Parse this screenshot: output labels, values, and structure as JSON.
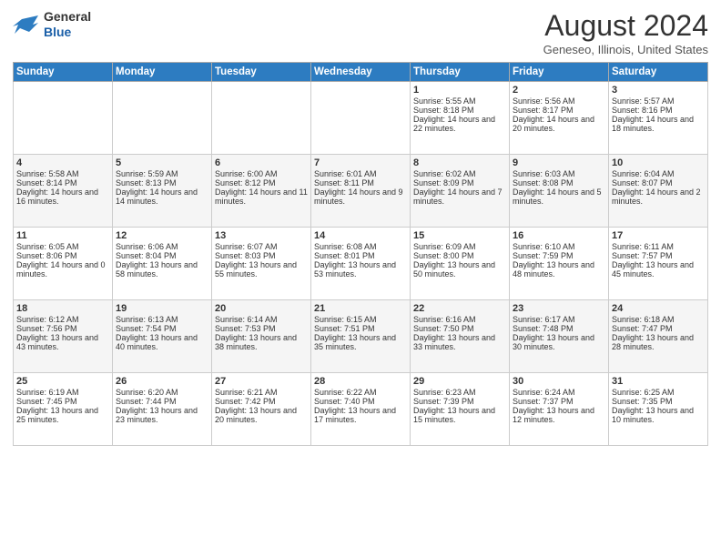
{
  "header": {
    "logo_general": "General",
    "logo_blue": "Blue",
    "month_year": "August 2024",
    "location": "Geneseo, Illinois, United States"
  },
  "weekdays": [
    "Sunday",
    "Monday",
    "Tuesday",
    "Wednesday",
    "Thursday",
    "Friday",
    "Saturday"
  ],
  "weeks": [
    [
      {
        "day": "",
        "info": ""
      },
      {
        "day": "",
        "info": ""
      },
      {
        "day": "",
        "info": ""
      },
      {
        "day": "",
        "info": ""
      },
      {
        "day": "1",
        "info": "Sunrise: 5:55 AM\nSunset: 8:18 PM\nDaylight: 14 hours and 22 minutes."
      },
      {
        "day": "2",
        "info": "Sunrise: 5:56 AM\nSunset: 8:17 PM\nDaylight: 14 hours and 20 minutes."
      },
      {
        "day": "3",
        "info": "Sunrise: 5:57 AM\nSunset: 8:16 PM\nDaylight: 14 hours and 18 minutes."
      }
    ],
    [
      {
        "day": "4",
        "info": "Sunrise: 5:58 AM\nSunset: 8:14 PM\nDaylight: 14 hours and 16 minutes."
      },
      {
        "day": "5",
        "info": "Sunrise: 5:59 AM\nSunset: 8:13 PM\nDaylight: 14 hours and 14 minutes."
      },
      {
        "day": "6",
        "info": "Sunrise: 6:00 AM\nSunset: 8:12 PM\nDaylight: 14 hours and 11 minutes."
      },
      {
        "day": "7",
        "info": "Sunrise: 6:01 AM\nSunset: 8:11 PM\nDaylight: 14 hours and 9 minutes."
      },
      {
        "day": "8",
        "info": "Sunrise: 6:02 AM\nSunset: 8:09 PM\nDaylight: 14 hours and 7 minutes."
      },
      {
        "day": "9",
        "info": "Sunrise: 6:03 AM\nSunset: 8:08 PM\nDaylight: 14 hours and 5 minutes."
      },
      {
        "day": "10",
        "info": "Sunrise: 6:04 AM\nSunset: 8:07 PM\nDaylight: 14 hours and 2 minutes."
      }
    ],
    [
      {
        "day": "11",
        "info": "Sunrise: 6:05 AM\nSunset: 8:06 PM\nDaylight: 14 hours and 0 minutes."
      },
      {
        "day": "12",
        "info": "Sunrise: 6:06 AM\nSunset: 8:04 PM\nDaylight: 13 hours and 58 minutes."
      },
      {
        "day": "13",
        "info": "Sunrise: 6:07 AM\nSunset: 8:03 PM\nDaylight: 13 hours and 55 minutes."
      },
      {
        "day": "14",
        "info": "Sunrise: 6:08 AM\nSunset: 8:01 PM\nDaylight: 13 hours and 53 minutes."
      },
      {
        "day": "15",
        "info": "Sunrise: 6:09 AM\nSunset: 8:00 PM\nDaylight: 13 hours and 50 minutes."
      },
      {
        "day": "16",
        "info": "Sunrise: 6:10 AM\nSunset: 7:59 PM\nDaylight: 13 hours and 48 minutes."
      },
      {
        "day": "17",
        "info": "Sunrise: 6:11 AM\nSunset: 7:57 PM\nDaylight: 13 hours and 45 minutes."
      }
    ],
    [
      {
        "day": "18",
        "info": "Sunrise: 6:12 AM\nSunset: 7:56 PM\nDaylight: 13 hours and 43 minutes."
      },
      {
        "day": "19",
        "info": "Sunrise: 6:13 AM\nSunset: 7:54 PM\nDaylight: 13 hours and 40 minutes."
      },
      {
        "day": "20",
        "info": "Sunrise: 6:14 AM\nSunset: 7:53 PM\nDaylight: 13 hours and 38 minutes."
      },
      {
        "day": "21",
        "info": "Sunrise: 6:15 AM\nSunset: 7:51 PM\nDaylight: 13 hours and 35 minutes."
      },
      {
        "day": "22",
        "info": "Sunrise: 6:16 AM\nSunset: 7:50 PM\nDaylight: 13 hours and 33 minutes."
      },
      {
        "day": "23",
        "info": "Sunrise: 6:17 AM\nSunset: 7:48 PM\nDaylight: 13 hours and 30 minutes."
      },
      {
        "day": "24",
        "info": "Sunrise: 6:18 AM\nSunset: 7:47 PM\nDaylight: 13 hours and 28 minutes."
      }
    ],
    [
      {
        "day": "25",
        "info": "Sunrise: 6:19 AM\nSunset: 7:45 PM\nDaylight: 13 hours and 25 minutes."
      },
      {
        "day": "26",
        "info": "Sunrise: 6:20 AM\nSunset: 7:44 PM\nDaylight: 13 hours and 23 minutes."
      },
      {
        "day": "27",
        "info": "Sunrise: 6:21 AM\nSunset: 7:42 PM\nDaylight: 13 hours and 20 minutes."
      },
      {
        "day": "28",
        "info": "Sunrise: 6:22 AM\nSunset: 7:40 PM\nDaylight: 13 hours and 17 minutes."
      },
      {
        "day": "29",
        "info": "Sunrise: 6:23 AM\nSunset: 7:39 PM\nDaylight: 13 hours and 15 minutes."
      },
      {
        "day": "30",
        "info": "Sunrise: 6:24 AM\nSunset: 7:37 PM\nDaylight: 13 hours and 12 minutes."
      },
      {
        "day": "31",
        "info": "Sunrise: 6:25 AM\nSunset: 7:35 PM\nDaylight: 13 hours and 10 minutes."
      }
    ]
  ]
}
